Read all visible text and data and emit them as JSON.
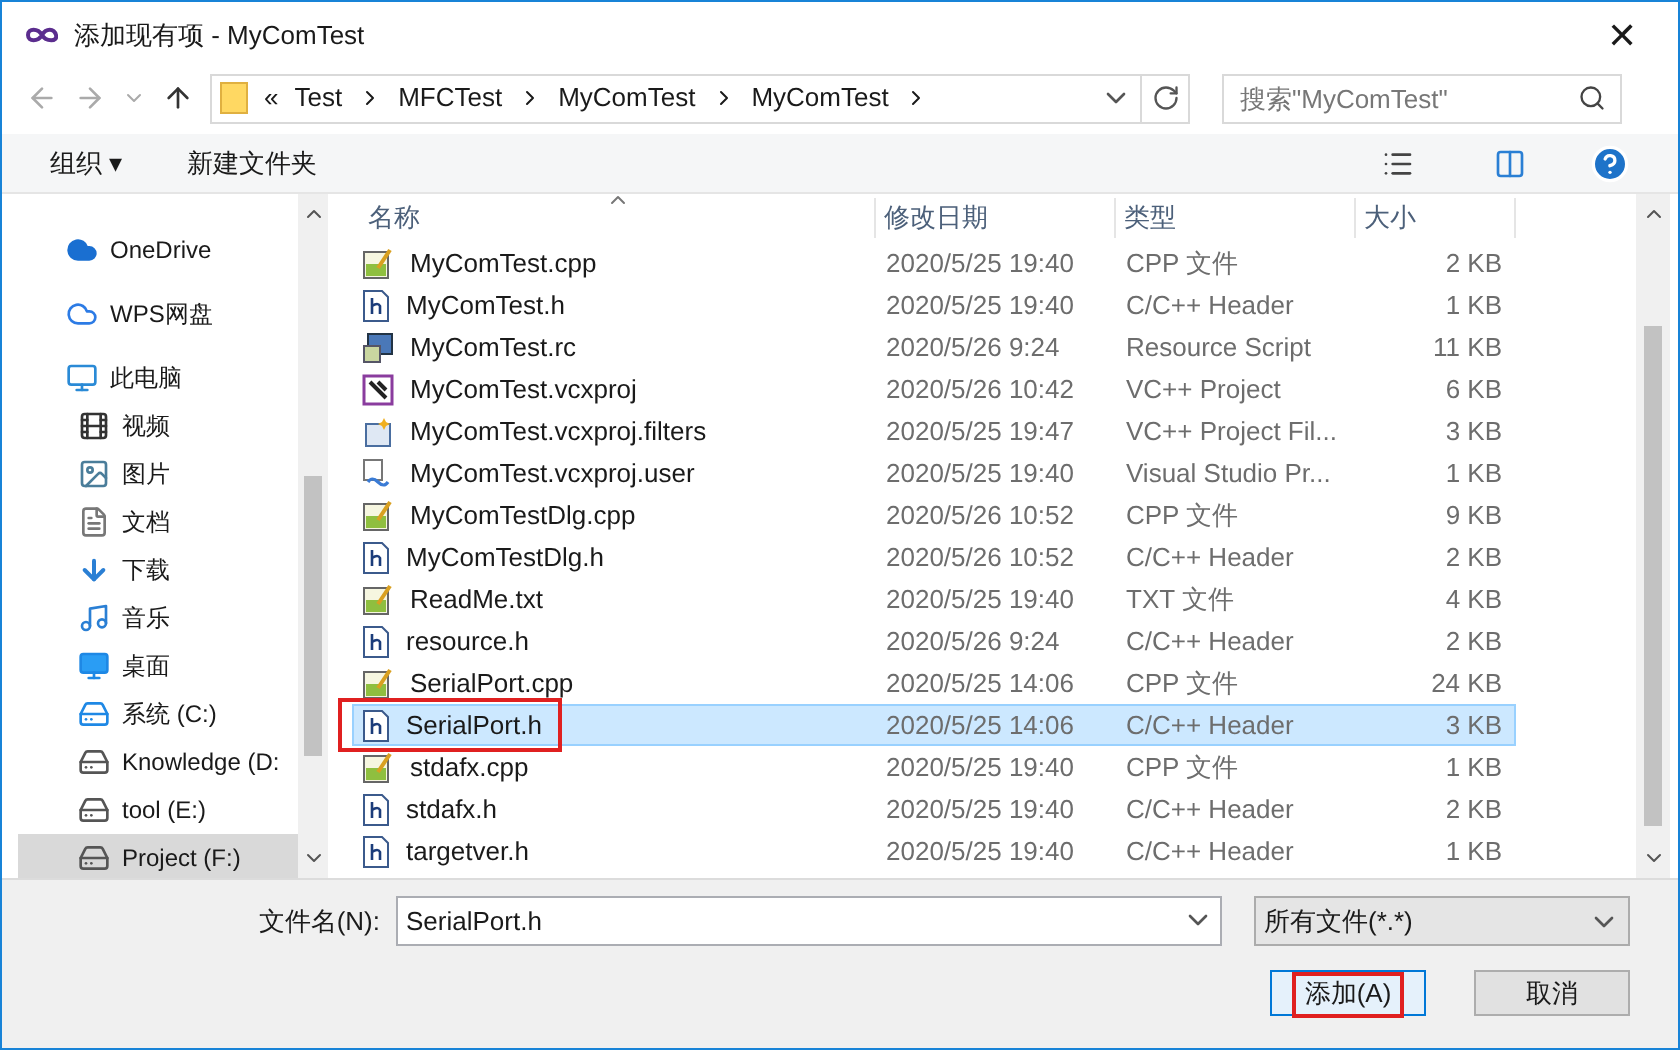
{
  "window": {
    "title": "添加现有项 - MyComTest",
    "close": "✕"
  },
  "address": {
    "crumbs": [
      "«",
      "Test",
      "MFCTest",
      "MyComTest",
      "MyComTest"
    ]
  },
  "search": {
    "placeholder": "搜索\"MyComTest\""
  },
  "toolbar": {
    "organize": "组织 ▾",
    "new_folder": "新建文件夹"
  },
  "sidebar": {
    "items": [
      {
        "label": "OneDrive",
        "kind": "cloud",
        "selected": false
      },
      {
        "label": "WPS网盘",
        "kind": "cloud2",
        "selected": false
      },
      {
        "label": "此电脑",
        "kind": "pc",
        "selected": false,
        "children": [
          {
            "label": "视频",
            "kind": "video",
            "selected": false
          },
          {
            "label": "图片",
            "kind": "image",
            "selected": false
          },
          {
            "label": "文档",
            "kind": "doc",
            "selected": false
          },
          {
            "label": "下载",
            "kind": "download",
            "selected": false
          },
          {
            "label": "音乐",
            "kind": "music",
            "selected": false
          },
          {
            "label": "桌面",
            "kind": "desktop",
            "selected": false
          },
          {
            "label": "系统 (C:)",
            "kind": "sysdrive",
            "selected": false
          },
          {
            "label": "Knowledge (D:",
            "kind": "drive",
            "selected": false
          },
          {
            "label": "tool (E:)",
            "kind": "drive",
            "selected": false
          },
          {
            "label": "Project (F:)",
            "kind": "drive",
            "selected": true
          }
        ]
      }
    ]
  },
  "table": {
    "columns": [
      "名称",
      "修改日期",
      "类型",
      "大小"
    ],
    "rows": [
      {
        "name": "MyComTest.cpp",
        "date": "2020/5/25 19:40",
        "type": "CPP 文件",
        "size": "2 KB",
        "kind": "cpp",
        "selected": false,
        "annotated": false
      },
      {
        "name": "MyComTest.h",
        "date": "2020/5/25 19:40",
        "type": "C/C++ Header",
        "size": "1 KB",
        "kind": "h",
        "selected": false,
        "annotated": false
      },
      {
        "name": "MyComTest.rc",
        "date": "2020/5/26 9:24",
        "type": "Resource Script",
        "size": "11 KB",
        "kind": "rc",
        "selected": false,
        "annotated": false
      },
      {
        "name": "MyComTest.vcxproj",
        "date": "2020/5/26 10:42",
        "type": "VC++ Project",
        "size": "6 KB",
        "kind": "proj",
        "selected": false,
        "annotated": false
      },
      {
        "name": "MyComTest.vcxproj.filters",
        "date": "2020/5/25 19:47",
        "type": "VC++ Project Fil...",
        "size": "3 KB",
        "kind": "filters",
        "selected": false,
        "annotated": false
      },
      {
        "name": "MyComTest.vcxproj.user",
        "date": "2020/5/25 19:40",
        "type": "Visual Studio Pr...",
        "size": "1 KB",
        "kind": "user",
        "selected": false,
        "annotated": false
      },
      {
        "name": "MyComTestDlg.cpp",
        "date": "2020/5/26 10:52",
        "type": "CPP 文件",
        "size": "9 KB",
        "kind": "cpp",
        "selected": false,
        "annotated": false
      },
      {
        "name": "MyComTestDlg.h",
        "date": "2020/5/26 10:52",
        "type": "C/C++ Header",
        "size": "2 KB",
        "kind": "h",
        "selected": false,
        "annotated": false
      },
      {
        "name": "ReadMe.txt",
        "date": "2020/5/25 19:40",
        "type": "TXT 文件",
        "size": "4 KB",
        "kind": "cpp",
        "selected": false,
        "annotated": false
      },
      {
        "name": "resource.h",
        "date": "2020/5/26 9:24",
        "type": "C/C++ Header",
        "size": "2 KB",
        "kind": "h",
        "selected": false,
        "annotated": false
      },
      {
        "name": "SerialPort.cpp",
        "date": "2020/5/25 14:06",
        "type": "CPP 文件",
        "size": "24 KB",
        "kind": "cpp",
        "selected": false,
        "annotated": false
      },
      {
        "name": "SerialPort.h",
        "date": "2020/5/25 14:06",
        "type": "C/C++ Header",
        "size": "3 KB",
        "kind": "h",
        "selected": true,
        "annotated": true
      },
      {
        "name": "stdafx.cpp",
        "date": "2020/5/25 19:40",
        "type": "CPP 文件",
        "size": "1 KB",
        "kind": "cpp",
        "selected": false,
        "annotated": false
      },
      {
        "name": "stdafx.h",
        "date": "2020/5/25 19:40",
        "type": "C/C++ Header",
        "size": "2 KB",
        "kind": "h",
        "selected": false,
        "annotated": false
      },
      {
        "name": "targetver.h",
        "date": "2020/5/25 19:40",
        "type": "C/C++ Header",
        "size": "1 KB",
        "kind": "h",
        "selected": false,
        "annotated": false
      }
    ]
  },
  "footer": {
    "filename_label": "文件名(N):",
    "filename": "SerialPort.h",
    "filter": "所有文件(*.*)",
    "buttons": [
      {
        "label": "添加(A)",
        "kind": "primary",
        "annotated": true
      },
      {
        "label": "取消",
        "kind": "normal",
        "annotated": false
      }
    ]
  }
}
